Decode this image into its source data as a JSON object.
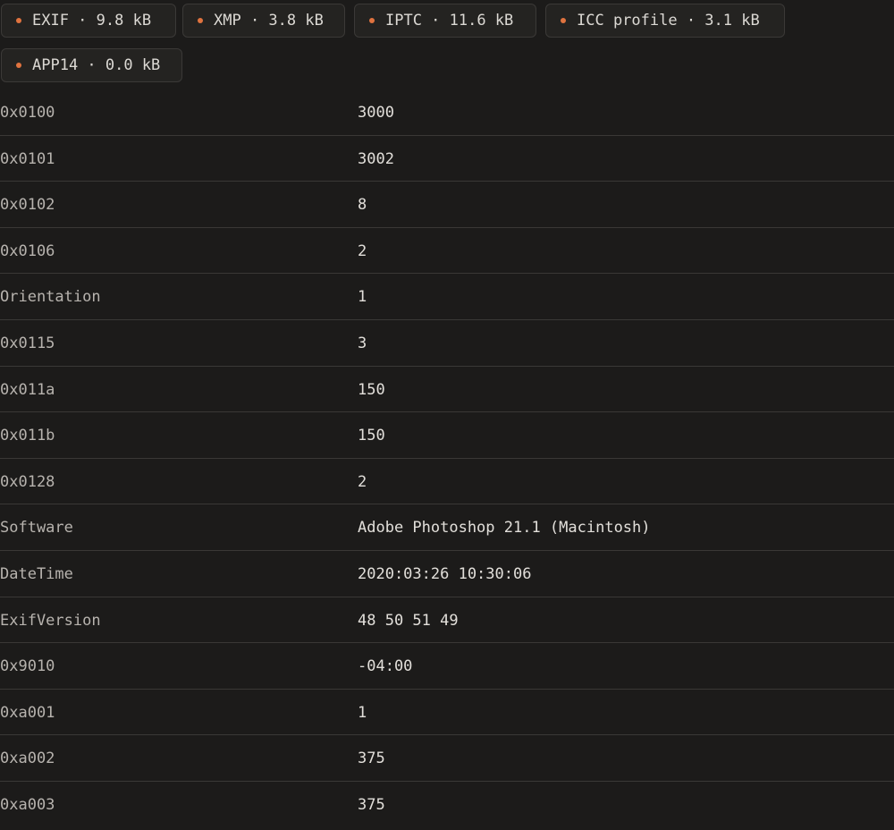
{
  "segments": [
    {
      "label": "EXIF · 9.8 kB",
      "name": "segment-chip-exif",
      "cls": "chip-exif"
    },
    {
      "label": "XMP · 3.8 kB",
      "name": "segment-chip-xmp",
      "cls": "chip-xmp"
    },
    {
      "label": "IPTC · 11.6 kB",
      "name": "segment-chip-iptc",
      "cls": "chip-iptc"
    },
    {
      "label": "ICC profile · 3.1 kB",
      "name": "segment-chip-icc-profile",
      "cls": "chip-icc"
    },
    {
      "label": "APP14 · 0.0 kB",
      "name": "segment-chip-app14",
      "cls": "chip-app14"
    }
  ],
  "accent_color": "#e0733f",
  "tags": [
    {
      "key": "0x0100",
      "value": "3000"
    },
    {
      "key": "0x0101",
      "value": "3002"
    },
    {
      "key": "0x0102",
      "value": "8"
    },
    {
      "key": "0x0106",
      "value": "2"
    },
    {
      "key": "Orientation",
      "value": "1"
    },
    {
      "key": "0x0115",
      "value": "3"
    },
    {
      "key": "0x011a",
      "value": "150"
    },
    {
      "key": "0x011b",
      "value": "150"
    },
    {
      "key": "0x0128",
      "value": "2"
    },
    {
      "key": "Software",
      "value": "Adobe Photoshop 21.1 (Macintosh)"
    },
    {
      "key": "DateTime",
      "value": "2020:03:26 10:30:06"
    },
    {
      "key": "ExifVersion",
      "value": "48 50 51 49"
    },
    {
      "key": "0x9010",
      "value": "-04:00"
    },
    {
      "key": "0xa001",
      "value": "1"
    },
    {
      "key": "0xa002",
      "value": "375"
    },
    {
      "key": "0xa003",
      "value": "375"
    }
  ]
}
